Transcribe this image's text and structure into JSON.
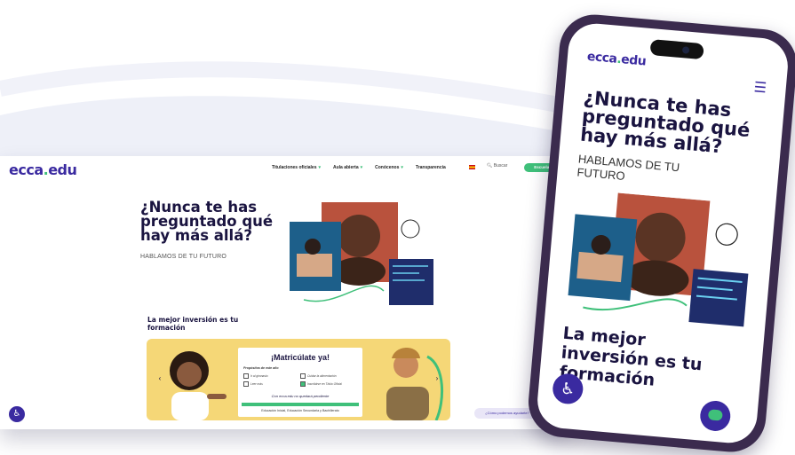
{
  "desktop": {
    "logo": {
      "main": "ecca",
      "dot": ".",
      "end": "edu"
    },
    "nav": {
      "items": [
        "Titulaciones oficiales",
        "Aula abierta",
        "Conócenos",
        "Transparencia"
      ],
      "search_label": "Buscar",
      "cta_label": "Escuelas"
    },
    "hero": {
      "title": "¿Nunca te has preguntado qué hay más allá?",
      "subtitle": "HABLAMOS DE TU FUTURO"
    },
    "section_title": "La mejor inversión es tu formación",
    "banner": {
      "title": "¡Matricúlate ya!",
      "subtitle": "Propósitos de este año",
      "checks": [
        "Ir al gimnasio",
        "Cuidar la alimentación",
        "Leer más",
        "Inscribirse en Título Oficial"
      ],
      "promo": "Con ecca.edu no quedará pendiente",
      "footer": "Educación Inicial, Educación Secundaria y Bachillerato"
    },
    "chat_label": "¿Cómo podemos ayudarte?"
  },
  "phone": {
    "logo": {
      "main": "ecca",
      "dot": ".",
      "end": "edu"
    },
    "hero": {
      "title": "¿Nunca te has preguntado qué hay más allá?",
      "subtitle": "HABLAMOS DE TU FUTURO"
    },
    "section_title": "La mejor inversión es tu formación"
  },
  "icons": {
    "accessibility": "accessibility-icon",
    "menu": "hamburger-menu-icon",
    "chat": "chat-icon",
    "search": "search-icon"
  },
  "colors": {
    "brand": "#3a2aa0",
    "accent": "#3fc07a",
    "banner": "#f5d777",
    "heading": "#1a1440"
  }
}
